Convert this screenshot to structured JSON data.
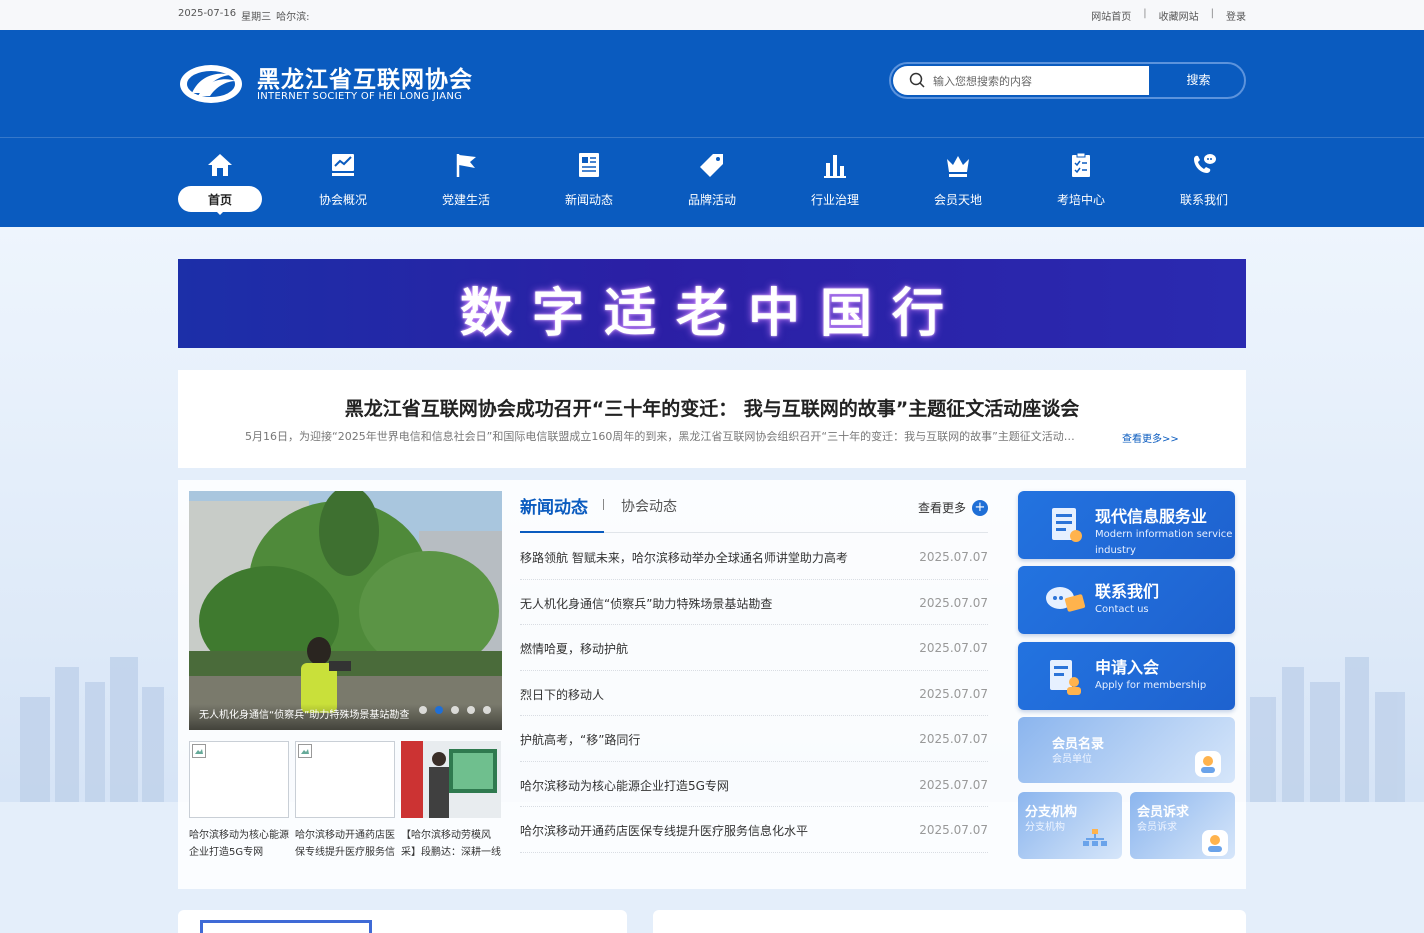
{
  "topbar": {
    "date": "2025-07-16",
    "weekday": "星期三",
    "city": "哈尔滨:",
    "links": [
      "网站首页",
      "|",
      "收藏网站",
      "|",
      "登录"
    ]
  },
  "header": {
    "logo_cn": "黑龙江省互联网协会",
    "logo_en": "INTERNET SOCIETY OF HEI LONG JIANG",
    "search_placeholder": "输入您想搜索的内容",
    "search_button": "搜索"
  },
  "nav": [
    {
      "label": "首页",
      "icon": "home-icon",
      "active": true
    },
    {
      "label": "协会概况",
      "icon": "chart-board-icon"
    },
    {
      "label": "党建生活",
      "icon": "flag-icon"
    },
    {
      "label": "新闻动态",
      "icon": "news-icon"
    },
    {
      "label": "品牌活动",
      "icon": "tag-icon"
    },
    {
      "label": "行业治理",
      "icon": "bar-chart-icon"
    },
    {
      "label": "会员天地",
      "icon": "crown-icon"
    },
    {
      "label": "考培中心",
      "icon": "clipboard-icon"
    },
    {
      "label": "联系我们",
      "icon": "phone-chat-icon"
    }
  ],
  "banner": {
    "title": "数字适老中国行"
  },
  "headline": {
    "title": "黑龙江省互联网协会成功召开“三十年的变迁： 我与互联网的故事”主题征文活动座谈会",
    "summary": "5月16日，为迎接“2025年世界电信和信息社会日”和国际电信联盟成立160周年的到来，黑龙江省互联网协会组织召开“三十年的变迁：我与互联网的故事”主题征文活动座谈会",
    "more": "查看更多>>"
  },
  "slider": {
    "caption": "无人机化身通信“侦察兵”助力特殊场景基站勘查",
    "dots": 5,
    "active_dot": 2
  },
  "thumbs": [
    {
      "caption": "哈尔滨移动为核心能源企业打造5G专网"
    },
    {
      "caption": "哈尔滨移动开通药店医保专线提升医疗服务信息化水平"
    },
    {
      "caption": "【哈尔滨移动劳模风采】段鹏达：深耕一线"
    }
  ],
  "news": {
    "tab_active": "新闻动态",
    "tab_other": "协会动态",
    "more": "查看更多",
    "items": [
      {
        "title": "移路领航 智赋未来，哈尔滨移动举办全球通名师讲堂助力高考",
        "date": "2025.07.07"
      },
      {
        "title": "无人机化身通信“侦察兵”助力特殊场景基站勘查",
        "date": "2025.07.07"
      },
      {
        "title": "燃情哈夏，移动护航",
        "date": "2025.07.07"
      },
      {
        "title": "烈日下的移动人",
        "date": "2025.07.07"
      },
      {
        "title": "护航高考，“移”路同行",
        "date": "2025.07.07"
      },
      {
        "title": "哈尔滨移动为核心能源企业打造5G专网",
        "date": "2025.07.07"
      },
      {
        "title": "哈尔滨移动开通药店医保专线提升医疗服务信息化水平",
        "date": "2025.07.07"
      }
    ]
  },
  "cards": {
    "modern": {
      "title": "现代信息服务业",
      "sub": "Modern information service industry"
    },
    "contact": {
      "title": "联系我们",
      "sub": "Contact us"
    },
    "join": {
      "title": "申请入会",
      "sub": "Apply for membership"
    },
    "members": {
      "title": "会员名录",
      "sub": "会员单位"
    },
    "branch": {
      "title": "分支机构",
      "sub": "分支机构"
    },
    "appeal": {
      "title": "会员诉求",
      "sub": "会员诉求"
    }
  },
  "colors": {
    "primary": "#0a5bbf",
    "accent": "#1f6fd6",
    "banner": "#2b1fa5"
  }
}
